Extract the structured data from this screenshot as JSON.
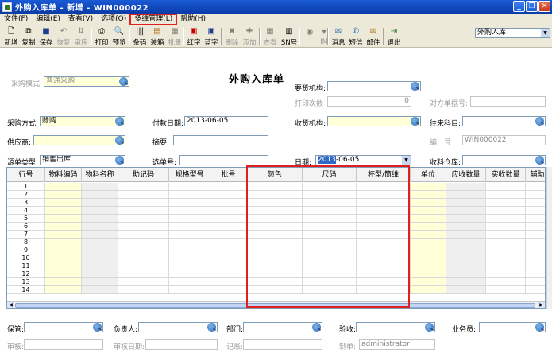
{
  "window": {
    "title": "外购入库单 - 新增 - WIN000022"
  },
  "menu": [
    "文件(F)",
    "编辑(E)",
    "查看(V)",
    "选项(O)",
    "多维管理(L)",
    "帮助(H)"
  ],
  "toolbar": {
    "buttons": [
      "新增",
      "复制",
      "保存",
      "恢复",
      "审序",
      "打印",
      "预览",
      "条码",
      "装箱",
      "批录",
      "红字",
      "蓝字",
      "删除",
      "添加",
      "查看",
      "SN号",
      "",
      "IM",
      "消息",
      "短信",
      "邮件",
      "退出"
    ],
    "combo_value": "外购入库"
  },
  "doc": {
    "title": "外购入库单"
  },
  "fields": {
    "purchase_mode_label": "采购模式:",
    "purchase_mode_value": "普通采购",
    "req_org_label": "要货机构:",
    "print_count_label": "打印次数",
    "print_count_value": "0",
    "counterpart_label": "对方单据号:",
    "purchase_method_label": "采购方式:",
    "purchase_method_value": "赊购",
    "pay_date_label": "付款日期:",
    "pay_date_value": "2013-06-05",
    "recv_org_label": "收货机构:",
    "account_label": "往来科目:",
    "supplier_label": "供应商:",
    "summary_label": "摘要:",
    "number_label": "编　号",
    "number_value": "WIN000022",
    "src_type_label": "源单类型:",
    "src_type_value": "销售出库",
    "select_no_label": "选单号:",
    "date_label": "日期:",
    "date_sel": "2013",
    "date_rest": "-06-05",
    "recv_wh_label": "收料仓库:",
    "keeper_label": "保管:",
    "manager_label": "负责人:",
    "dept_label": "部门:",
    "inspect_label": "验收:",
    "clerk_label": "业务员:",
    "auditor_label": "审核:",
    "audit_date_label": "审核日期:",
    "post_label": "记账:",
    "maker_label": "制单:",
    "maker_value": "administrator"
  },
  "grid": {
    "columns": [
      "行号",
      "物料编码",
      "物料名称",
      "助记码",
      "规格型号",
      "批号",
      "颜色",
      "尺码",
      "杯型/筒维",
      "单位",
      "应收数量",
      "实收数量",
      "辅助"
    ],
    "rows": [
      "1",
      "2",
      "3",
      "4",
      "5",
      "6",
      "7",
      "8",
      "9",
      "10",
      "11",
      "12",
      "13",
      "14"
    ]
  }
}
